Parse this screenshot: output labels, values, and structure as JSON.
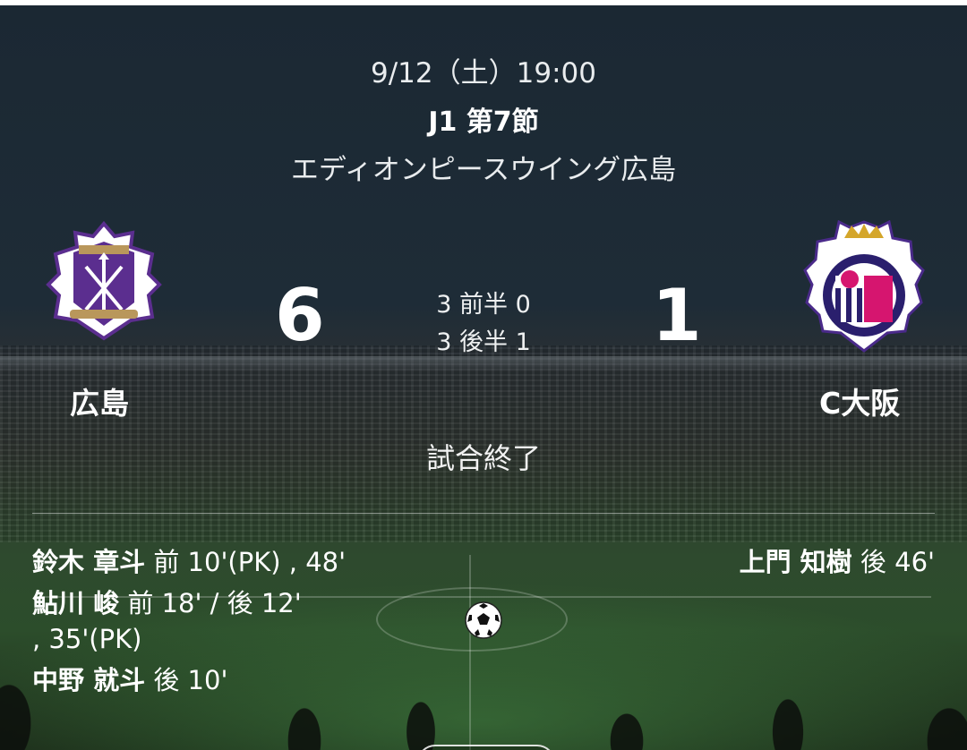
{
  "match": {
    "datetime": "9/12（土）19:00",
    "round": "J1 第7節",
    "venue": "エディオンピースウイング広島",
    "status": "試合終了"
  },
  "home": {
    "name": "広島",
    "score": "6",
    "crest_text": "SANFRECCE HIROSHIMA",
    "crest_since": "SINCE 1938",
    "color": "#5b2e8f"
  },
  "away": {
    "name": "C大阪",
    "score": "1",
    "crest_text": "CEREZO OSAKA",
    "color": "#d6156f"
  },
  "halves": {
    "first": "3 前半 0",
    "second": "3 後半 1"
  },
  "scorers": {
    "home": [
      {
        "player": "鈴木 章斗",
        "times": "前 10'(PK) , 48'"
      },
      {
        "player": "鮎川 峻",
        "times": "前 18'  /  後 12'",
        "cont": ", 35'(PK)"
      },
      {
        "player": "中野 就斗",
        "times": "後 10'"
      }
    ],
    "away": [
      {
        "player": "上門 知樹",
        "times": "後 46'"
      }
    ]
  },
  "icons": {
    "ball": "soccer-ball-icon"
  }
}
